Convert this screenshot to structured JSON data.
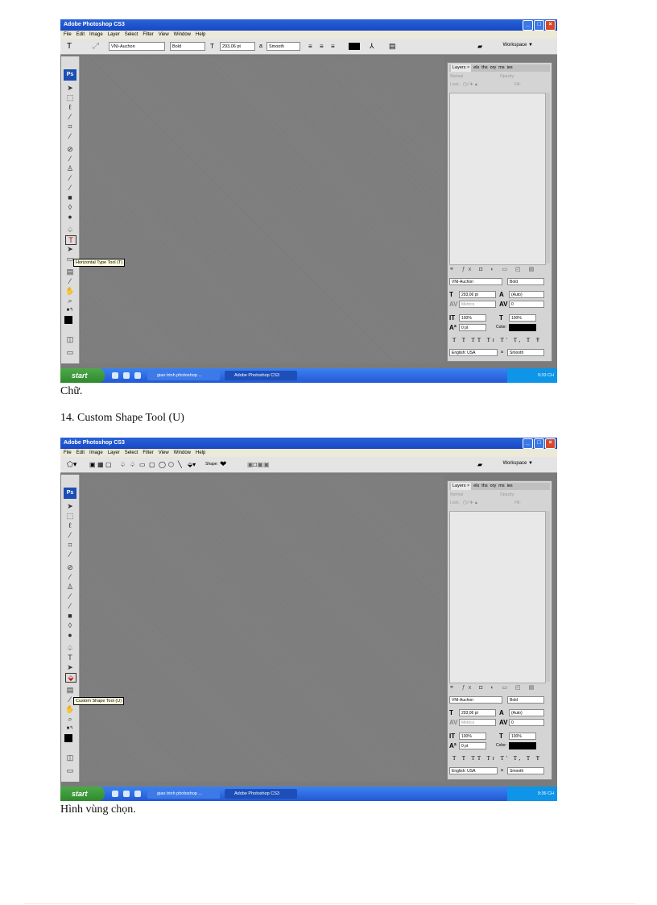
{
  "screenshots": [
    {
      "app_title": "Adobe Photoshop CS3",
      "menu": [
        "File",
        "Edit",
        "Image",
        "Layer",
        "Select",
        "Filter",
        "View",
        "Window",
        "Help"
      ],
      "options": {
        "tool_glyph": "T",
        "font_family": "VNI-Auchon",
        "font_style": "Bold",
        "font_size": "293,06 pt",
        "anti_alias_label": "a",
        "anti_alias": "Smooth",
        "workspace": "Workspace ▼"
      },
      "tooltip": "Horizontal Type Tool (T)",
      "panel": {
        "tabs": [
          "Layers ×",
          "els",
          "ths",
          "ory",
          "ms",
          "ies"
        ],
        "blend": "Normal",
        "opacity": "Opacity:",
        "lock": "Lock:",
        "fill": "Fill:",
        "char": {
          "font": "VNI-Auchon",
          "style": "Bold",
          "size": "293,06 pt",
          "leading": "(Auto)",
          "kerning": "Metrics",
          "tracking": "0",
          "v_scale": "100%",
          "h_scale": "100%",
          "baseline": "0 pt",
          "color_label": "Color:",
          "buttons": "T T TT Tr T' T, T Ŧ",
          "language": "English: USA",
          "aa_label": "a",
          "aa": "Smooth"
        }
      },
      "taskbar": {
        "start": "start",
        "task1": "giao trinh photoshop ...",
        "task2": "Adobe Photoshop CS3",
        "clock": "9:33 CH"
      }
    },
    {
      "app_title": "Adobe Photoshop CS3",
      "menu": [
        "File",
        "Edit",
        "Image",
        "Layer",
        "Select",
        "Filter",
        "View",
        "Window",
        "Help"
      ],
      "options": {
        "shape_label": "Shape:",
        "heart": "❤",
        "workspace": "Workspace ▼"
      },
      "tooltip": "Custom Shape Tool (U)",
      "panel": {
        "tabs": [
          "Layers ×",
          "els",
          "ths",
          "ory",
          "ms",
          "ies"
        ],
        "blend": "Normal",
        "opacity": "Opacity:",
        "lock": "Lock:",
        "fill": "Fill:",
        "char": {
          "font": "VNI-Auchon",
          "style": "Bold",
          "size": "293,06 pt",
          "leading": "(Auto)",
          "kerning": "Metrics",
          "tracking": "0",
          "v_scale": "100%",
          "h_scale": "100%",
          "baseline": "0 pt",
          "color_label": "Color:",
          "buttons": "T T TT Tr T' T, T Ŧ",
          "language": "English: USA",
          "aa_label": "a",
          "aa": "Smooth"
        }
      },
      "taskbar": {
        "start": "start",
        "task1": "giao trinh photoshop ...",
        "task2": "Adobe Photoshop CS3",
        "clock": "9:36 CH"
      }
    }
  ],
  "captions": {
    "after_first": "Chữ.",
    "heading": "14. Custom Shape Tool (U)",
    "after_second": "Hình vùng chọn."
  }
}
